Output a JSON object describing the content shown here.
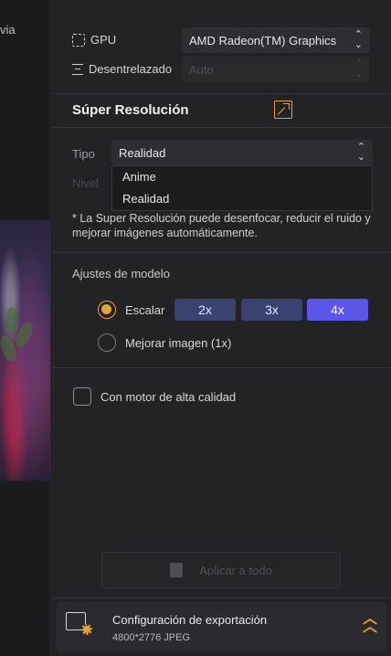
{
  "preview": {
    "label": "via"
  },
  "gpu": {
    "label": "GPU",
    "value": "AMD Radeon(TM) Graphics"
  },
  "deinterlace": {
    "label": "Desentrelazado",
    "value": "Auto"
  },
  "super_resolution": {
    "title": "Súper Resolución",
    "type_label": "Tipo",
    "type_value": "Realidad",
    "level_label": "Nivel",
    "options": [
      "Anime",
      "Realidad"
    ],
    "note": "* La Super Resolución puede desenfocar, reducir el ruido y mejorar imágenes automáticamente."
  },
  "model": {
    "title": "Ajustes de modelo",
    "scale_label": "Escalar",
    "scale_options": [
      "2x",
      "3x",
      "4x"
    ],
    "selected_scale": "4x",
    "enhance_label": "Mejorar imagen (1x)"
  },
  "quality_engine": {
    "label": "Con motor de alta calidad",
    "checked": false
  },
  "apply_all": {
    "label": "Aplicar a todo"
  },
  "export": {
    "title": "Configuración de exportación",
    "details": "4800*2776  JPEG"
  },
  "colors": {
    "accent": "#e8a23a",
    "scale_active": "#5b55e8",
    "scale_inactive": "#3a4370"
  }
}
